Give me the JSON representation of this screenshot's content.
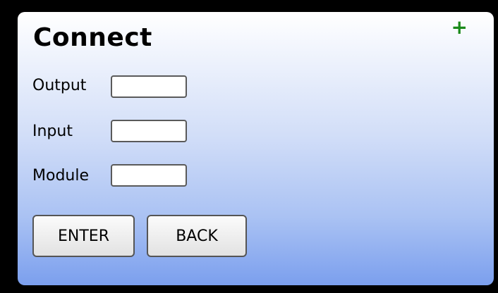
{
  "dialog": {
    "title": "Connect",
    "add_icon": "+"
  },
  "fields": {
    "output": {
      "label": "Output",
      "value": ""
    },
    "input": {
      "label": "Input",
      "value": ""
    },
    "module": {
      "label": "Module",
      "value": ""
    }
  },
  "buttons": {
    "enter_label": "ENTER",
    "back_label": "BACK"
  }
}
